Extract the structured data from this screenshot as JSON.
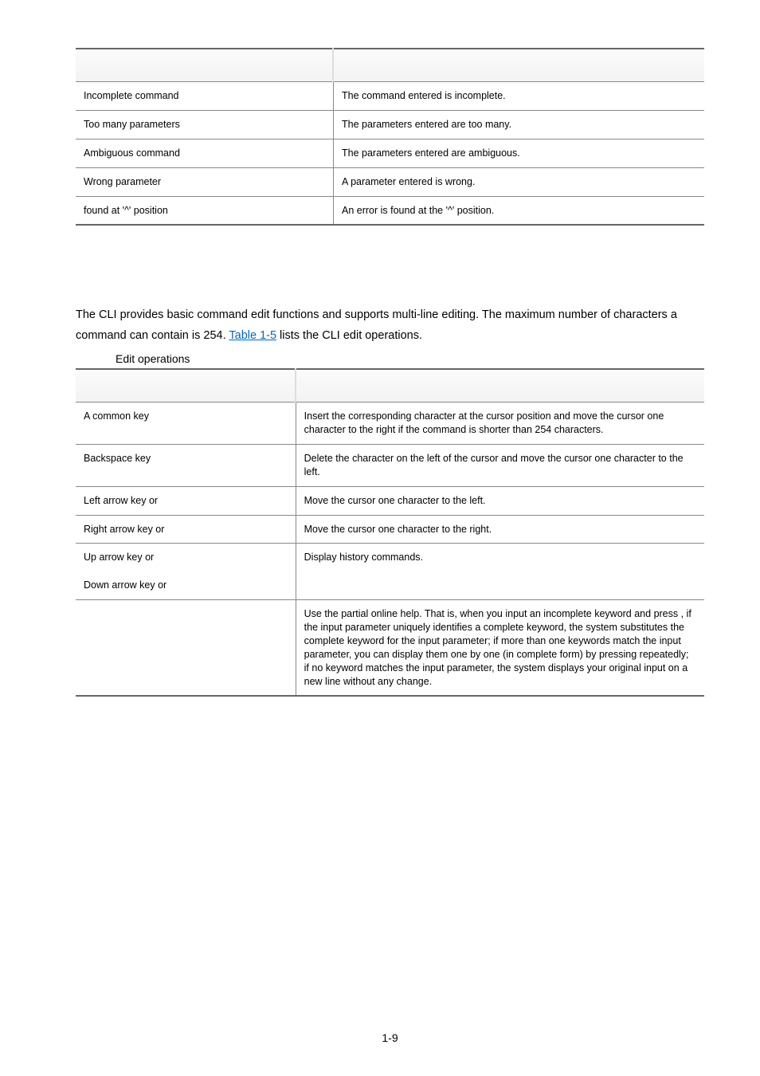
{
  "table1": {
    "rows": [
      {
        "c1": "Incomplete command",
        "c2": "The command entered is incomplete."
      },
      {
        "c1": "Too many parameters",
        "c2": "The parameters entered are too many."
      },
      {
        "c1": "Ambiguous command",
        "c2": "The parameters entered are ambiguous."
      },
      {
        "c1": "Wrong parameter",
        "c2": "A parameter entered is wrong."
      },
      {
        "c1": "found at '^' position",
        "c2": "An error is found at the '^' position."
      }
    ]
  },
  "para_pre": "The CLI provides basic command edit functions and supports multi-line editing. The maximum number of characters a command can contain is 254. ",
  "para_link": "Table 1-5",
  "para_post": " lists the CLI edit operations.",
  "caption": "Edit operations",
  "table2": {
    "rows": [
      {
        "c1": "A common key",
        "c2": "Insert the corresponding character at the cursor position and move the cursor one character to the right if the command is shorter than 254 characters."
      },
      {
        "c1": "Backspace key",
        "c2": "Delete the character on the left of the cursor and move the cursor one character to the left."
      },
      {
        "c1": "Left arrow key or",
        "c2": "Move the cursor one character to the left."
      },
      {
        "c1": "Right arrow key or",
        "c2": "Move the cursor one character to the right."
      },
      {
        "c1a": "Up arrow key or",
        "c1b": "Down arrow key or",
        "c2": "Display history commands."
      },
      {
        "c1": "",
        "c2": "Use the partial online help. That is, when you input an incomplete keyword and press       , if the input parameter uniquely identifies a complete keyword, the system substitutes the complete keyword for the input parameter; if more than one keywords match the input parameter, you can display them one by one (in complete form) by pressing        repeatedly; if no keyword matches the input parameter, the system displays your original input on a new line without any change."
      }
    ]
  },
  "footer": "1-9"
}
